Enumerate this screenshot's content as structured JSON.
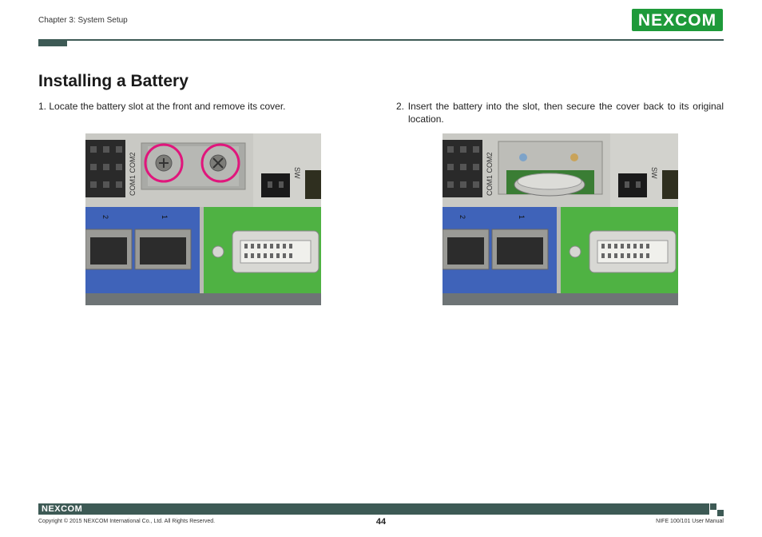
{
  "header": {
    "chapter": "Chapter 3: System Setup",
    "logo_text": "NEXCOM",
    "brand_color": "#1e9a3a",
    "bar_color": "#3d5a55"
  },
  "content": {
    "title": "Installing a Battery",
    "step1": "1. Locate the battery slot at the front and remove its cover.",
    "step2": "2. Insert the battery into the slot, then secure the cover back to its original location.",
    "photo_labels": {
      "com": "COM1 COM2",
      "sw": "SW",
      "lan2": "2",
      "lan1": "1"
    }
  },
  "footer": {
    "logo_text": "NEXCOM",
    "copyright": "Copyright © 2015 NEXCOM International Co., Ltd. All Rights Reserved.",
    "page_number": "44",
    "manual_name": "NIFE 100/101 User Manual"
  }
}
